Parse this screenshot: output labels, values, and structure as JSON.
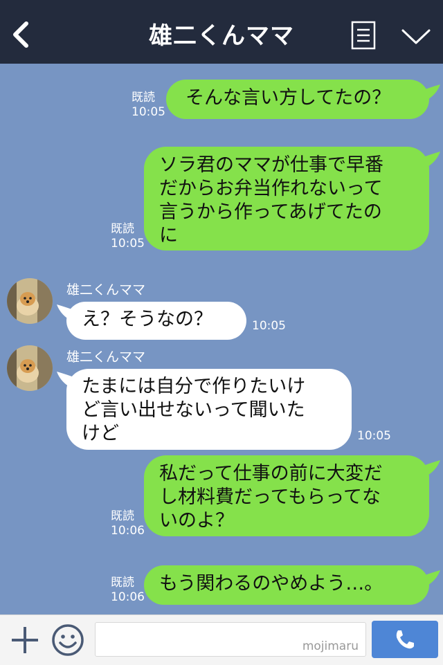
{
  "header": {
    "title": "雄二くんママ"
  },
  "messages": [
    {
      "side": "me",
      "lines": [
        "そんな言い方してたの？"
      ],
      "read": "既読",
      "time": "10:05"
    },
    {
      "side": "me",
      "lines": [
        "ソラ君のママが仕事で早番",
        "だからお弁当作れないって",
        "言うから作ってあげてたの",
        "に"
      ],
      "read": "既読",
      "time": "10:05"
    },
    {
      "side": "them",
      "sender": "雄二くんママ",
      "lines": [
        "え？そうなの？"
      ],
      "time": "10:05"
    },
    {
      "side": "them",
      "sender": "雄二くんママ",
      "lines": [
        "たまには自分で作りたいけ",
        "ど言い出せないって聞いた",
        "けど"
      ],
      "time": "10:05"
    },
    {
      "side": "me",
      "lines": [
        "私だって仕事の前に大変だ",
        "し材料費だってもらってな",
        "いのよ？"
      ],
      "read": "既読",
      "time": "10:06"
    },
    {
      "side": "me",
      "lines": [
        "もう関わるのやめよう…。"
      ],
      "read": "既読",
      "time": "10:06"
    }
  ],
  "footer": {
    "watermark": "mojimaru"
  },
  "icons": {
    "back": "chevron-left-icon",
    "menu": "notes-icon",
    "collapse": "chevron-down-icon",
    "add": "plus-icon",
    "emoji": "smile-icon",
    "call": "phone-icon"
  },
  "colors": {
    "header": "#232b3d",
    "background": "#7795c3",
    "my_bubble": "#85e14b",
    "their_bubble": "#ffffff",
    "call_button": "#4e86d6"
  }
}
